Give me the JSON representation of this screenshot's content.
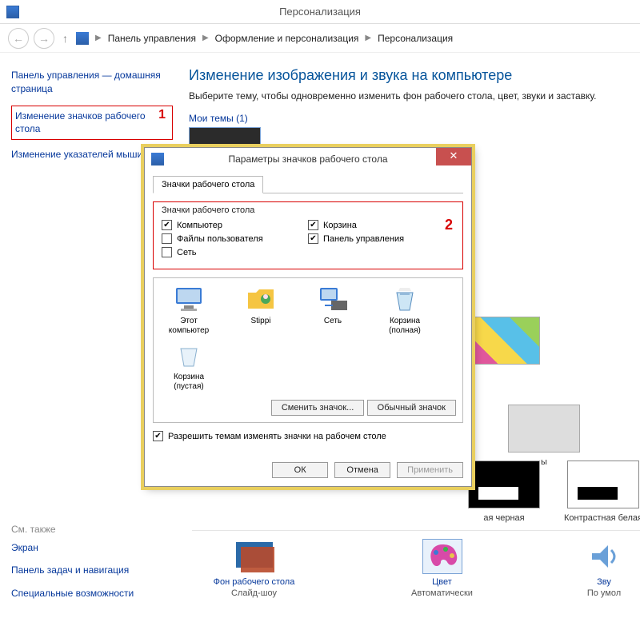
{
  "window": {
    "title": "Персонализация"
  },
  "breadcrumb": {
    "c1": "Панель управления",
    "c2": "Оформление и персонализация",
    "c3": "Персонализация"
  },
  "annotations": {
    "one": "1",
    "two": "2"
  },
  "sidebar": {
    "home": "Панель управления — домашняя страница",
    "change_icons": "Изменение значков рабочего стола",
    "change_pointers": "Изменение указателей мыши",
    "see_also": "См. также",
    "screen": "Экран",
    "taskbar": "Панель задач и навигация",
    "ease": "Специальные возможности"
  },
  "main": {
    "h1": "Изменение изображения и звука на компьютере",
    "sub": "Выберите тему, чтобы одновременно изменить фон рабочего стола, цвет, звуки и заставку.",
    "my_themes": "Мои темы (1)"
  },
  "themes": {
    "gray_suffix": "ы",
    "hc_black": "ая черная",
    "hc_white": "Контрастная белая"
  },
  "bottom": {
    "bg_title": "Фон рабочего стола",
    "bg_val": "Слайд-шоу",
    "color_title": "Цвет",
    "color_val": "Автоматически",
    "sound_title": "Зву",
    "sound_val": "По умол"
  },
  "dialog": {
    "title": "Параметры значков рабочего стола",
    "tab": "Значки рабочего стола",
    "group": "Значки рабочего стола",
    "chk_computer": "Компьютер",
    "chk_userfiles": "Файлы пользователя",
    "chk_network": "Сеть",
    "chk_recycle": "Корзина",
    "chk_cpanel": "Панель управления",
    "icon_this_pc": "Этот компьютер",
    "icon_user": "Stippi",
    "icon_net": "Сеть",
    "icon_bin_full": "Корзина (полная)",
    "icon_bin_empty": "Корзина (пустая)",
    "btn_change": "Сменить значок...",
    "btn_default": "Обычный значок",
    "allow_themes": "Разрешить темам изменять значки на рабочем столе",
    "ok": "ОК",
    "cancel": "Отмена",
    "apply": "Применить"
  }
}
